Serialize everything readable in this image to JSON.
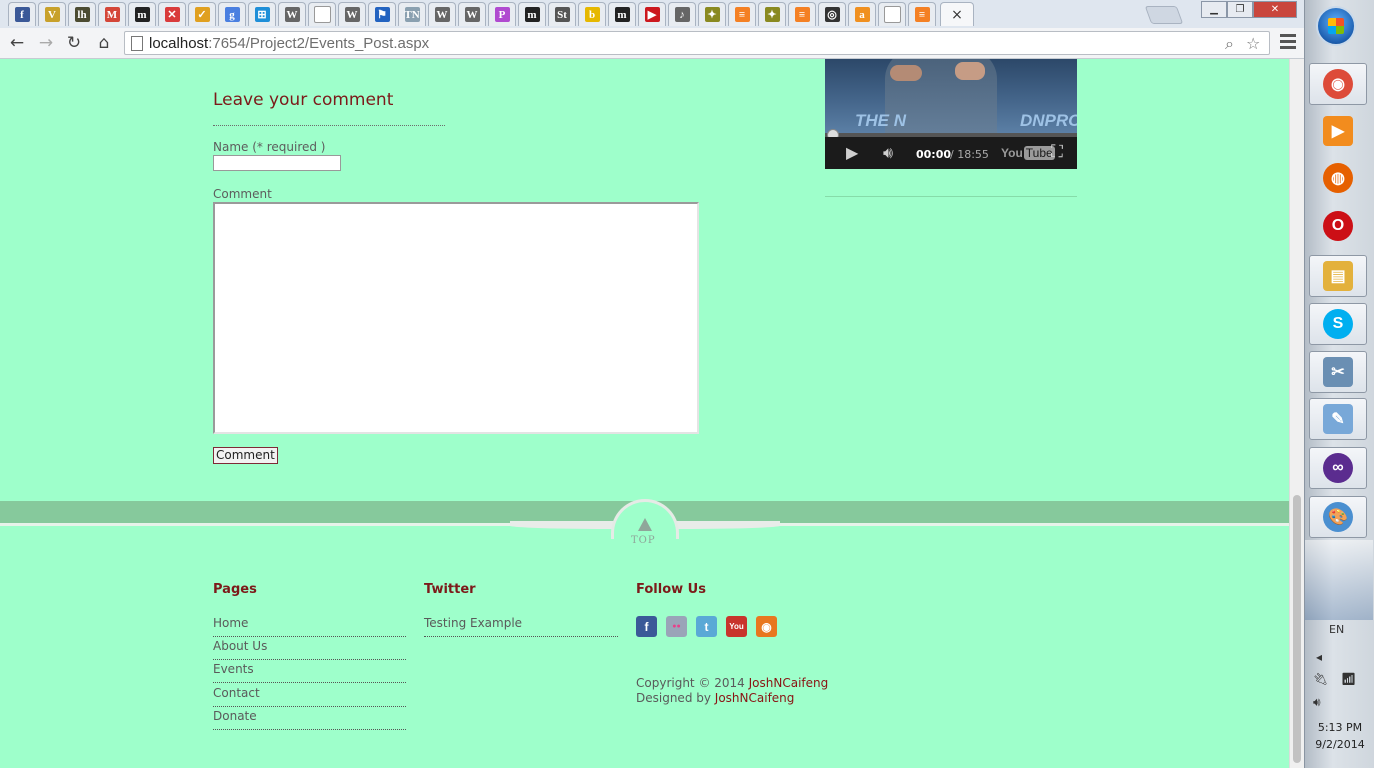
{
  "browser": {
    "tabs": [
      {
        "name": "facebook",
        "glyph": "f",
        "color": "#3b5998"
      },
      {
        "name": "v-site",
        "glyph": "V",
        "color": "#c8a12b"
      },
      {
        "name": "lh-site",
        "glyph": "lh",
        "color": "#4c4c32"
      },
      {
        "name": "gmail",
        "glyph": "M",
        "color": "#d44638"
      },
      {
        "name": "m-site",
        "glyph": "m",
        "color": "#222222"
      },
      {
        "name": "x-site",
        "glyph": "✕",
        "color": "#d93b3b"
      },
      {
        "name": "check-site",
        "glyph": "✓",
        "color": "#e0a020"
      },
      {
        "name": "google",
        "glyph": "g",
        "color": "#4a7fe0"
      },
      {
        "name": "windows",
        "glyph": "⊞",
        "color": "#1f8fd8"
      },
      {
        "name": "wikipedia",
        "glyph": "W",
        "color": "#666666"
      },
      {
        "name": "blank",
        "glyph": "",
        "color": "#ffffff"
      },
      {
        "name": "wikipedia",
        "glyph": "W",
        "color": "#666666"
      },
      {
        "name": "flag-site",
        "glyph": "⚑",
        "color": "#2363c0"
      },
      {
        "name": "tn-site",
        "glyph": "TN",
        "color": "#8aa0b0"
      },
      {
        "name": "wikipedia",
        "glyph": "W",
        "color": "#666666"
      },
      {
        "name": "wikipedia",
        "glyph": "W",
        "color": "#666666"
      },
      {
        "name": "pin-site",
        "glyph": "P",
        "color": "#b04ad0"
      },
      {
        "name": "m-site",
        "glyph": "m",
        "color": "#222222"
      },
      {
        "name": "st-site",
        "glyph": "St",
        "color": "#555555"
      },
      {
        "name": "bing",
        "glyph": "b",
        "color": "#e6b800"
      },
      {
        "name": "m-site",
        "glyph": "m",
        "color": "#222222"
      },
      {
        "name": "youtube",
        "glyph": "▶",
        "color": "#cc181e"
      },
      {
        "name": "audio-site",
        "glyph": "♪",
        "color": "#666666"
      },
      {
        "name": "badge-site",
        "glyph": "✦",
        "color": "#8a8a20"
      },
      {
        "name": "stack-overflow",
        "glyph": "≡",
        "color": "#f48024"
      },
      {
        "name": "badge-site",
        "glyph": "✦",
        "color": "#8a8a20"
      },
      {
        "name": "stack-overflow",
        "glyph": "≡",
        "color": "#f48024"
      },
      {
        "name": "circle-site",
        "glyph": "◎",
        "color": "#333333"
      },
      {
        "name": "orange-site",
        "glyph": "a",
        "color": "#f09020"
      },
      {
        "name": "blank",
        "glyph": "",
        "color": "#ffffff"
      },
      {
        "name": "stack-overflow",
        "glyph": "≡",
        "color": "#f48024"
      }
    ],
    "active_tab_close": "×",
    "url_host": "localhost",
    "url_rest": ":7654/Project2/Events_Post.aspx"
  },
  "comment_form": {
    "title": "Leave your comment",
    "name_label": "Name (* required )",
    "comment_label": "Comment",
    "submit_label": "Comment"
  },
  "video": {
    "banner_left": "THE N",
    "banner_right": "DNPRO",
    "time_current": "00:00",
    "time_total": "/ 18:55",
    "logo_you": "You",
    "logo_tube": "Tube"
  },
  "footer": {
    "top_label": "TOP",
    "pages_title": "Pages",
    "pages": [
      "Home",
      "About Us",
      "Events",
      "Contact",
      "Donate"
    ],
    "twitter_title": "Twitter",
    "twitter_items": [
      "Testing Example"
    ],
    "follow_title": "Follow Us",
    "social": [
      {
        "name": "facebook",
        "glyph": "f",
        "color": "#3b5998"
      },
      {
        "name": "flickr",
        "glyph": "●●",
        "color": "#9aa4b8"
      },
      {
        "name": "twitter",
        "glyph": "t",
        "color": "#5aa9d6"
      },
      {
        "name": "youtube",
        "glyph": "You",
        "color": "#c8342c"
      },
      {
        "name": "rss",
        "glyph": "◉",
        "color": "#e8771f"
      }
    ],
    "copyright_prefix": "Copyright © 2014 ",
    "copyright_name": "JoshNCaifeng",
    "designed_prefix": "Designed by ",
    "designed_name": "JoshNCaifeng"
  },
  "taskbar": {
    "apps": [
      {
        "name": "chrome",
        "glyph": "◉",
        "color": "#dd4b39"
      },
      {
        "name": "media-player",
        "glyph": "▶",
        "color": "#f28c1e"
      },
      {
        "name": "firefox",
        "glyph": "◍",
        "color": "#e66000"
      },
      {
        "name": "opera",
        "glyph": "O",
        "color": "#cc0f16"
      },
      {
        "name": "file-explorer",
        "glyph": "▤",
        "color": "#e3b13c"
      },
      {
        "name": "skype",
        "glyph": "S",
        "color": "#00aff0"
      },
      {
        "name": "tools",
        "glyph": "✂",
        "color": "#6a8fb3"
      },
      {
        "name": "notepad",
        "glyph": "✎",
        "color": "#78a8d8"
      },
      {
        "name": "visual-studio",
        "glyph": "∞",
        "color": "#5b2c8f"
      },
      {
        "name": "paint",
        "glyph": "🎨",
        "color": "#4a8fd0"
      }
    ],
    "language": "EN",
    "time": "5:13 PM",
    "date": "9/2/2014"
  }
}
